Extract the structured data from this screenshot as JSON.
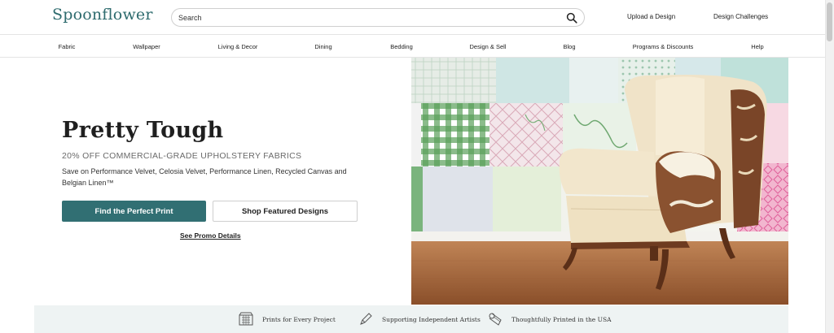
{
  "header": {
    "logo": "Spoonflower",
    "search": {
      "placeholder": "Search",
      "value": ""
    },
    "links": [
      "Upload a Design",
      "Design Challenges"
    ]
  },
  "nav": {
    "items": [
      "Fabric",
      "Wallpaper",
      "Living & Decor",
      "Dining",
      "Bedding",
      "Design & Sell",
      "Blog",
      "Programs & Discounts",
      "Help"
    ]
  },
  "hero": {
    "title": "Pretty Tough",
    "subtitle": "20% OFF COMMERCIAL-GRADE UPHOLSTERY FABRICS",
    "description": "Save on Performance Velvet, Celosia Velvet, Performance Linen, Recycled Canvas and Belgian Linen™",
    "primary_button": "Find the Perfect Print",
    "secondary_button": "Shop Featured Designs",
    "promo_link": "See Promo Details"
  },
  "features": {
    "items": [
      {
        "label": "Prints for Every Project",
        "icon": "fabric-swatches-icon"
      },
      {
        "label": "Supporting Independent Artists",
        "icon": "pencil-icon"
      },
      {
        "label": "Thoughtfully Printed in the USA",
        "icon": "fabric-roll-icon"
      }
    ]
  },
  "colors": {
    "brand": "#2e6b6e",
    "primary_button": "#316f73",
    "features_band": "#eef3f3"
  }
}
